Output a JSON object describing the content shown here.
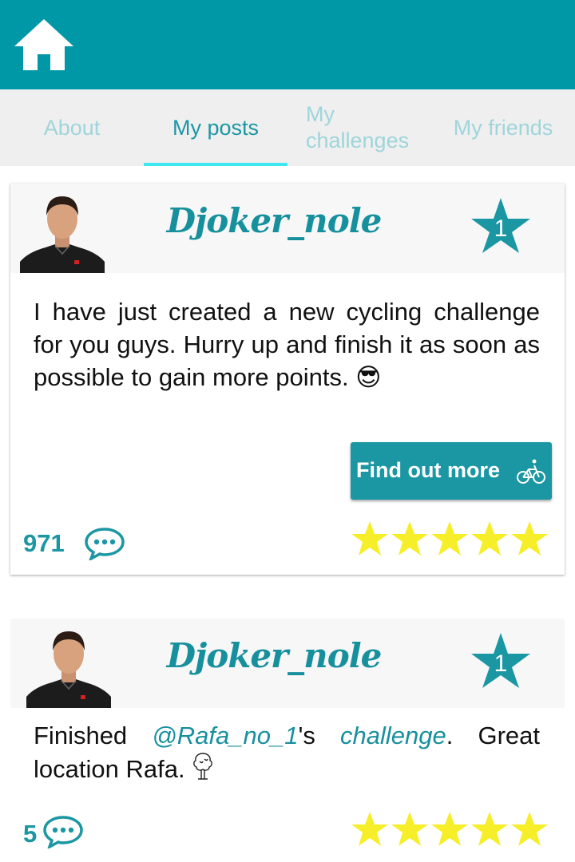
{
  "header": {
    "home_icon": "home-icon",
    "color": "#0097a7"
  },
  "tabs": [
    {
      "label": "About",
      "active": false
    },
    {
      "label": "My posts",
      "active": true
    },
    {
      "label": "My challenges",
      "line1": "My",
      "line2": "challenges",
      "active": false
    },
    {
      "label": "My friends",
      "active": false
    }
  ],
  "posts": [
    {
      "username": "Djoker_nole",
      "rank": "1",
      "text": "I have just created a new cycling challenge for you guys. Hurry up and finish it as soon as possible to gain more points.",
      "emoji": "😎",
      "button": {
        "label": "Find out more",
        "icon": "bicycle-icon"
      },
      "comment_count": "971",
      "rating": 5
    },
    {
      "username": "Djoker_nole",
      "rank": "1",
      "text_prefix": "Finished ",
      "mention": "@Rafa_no_1",
      "text_mid": "'s ",
      "challenge_link": "challenge",
      "text_suffix": ".  Great location Rafa.",
      "emoji": "tree-icon",
      "comment_count": "5",
      "rating": 5
    }
  ],
  "colors": {
    "accent": "#1a97a3",
    "tab_inactive": "#9fd5db",
    "underline": "#3ee8f0",
    "star": "#f7ee2a"
  }
}
